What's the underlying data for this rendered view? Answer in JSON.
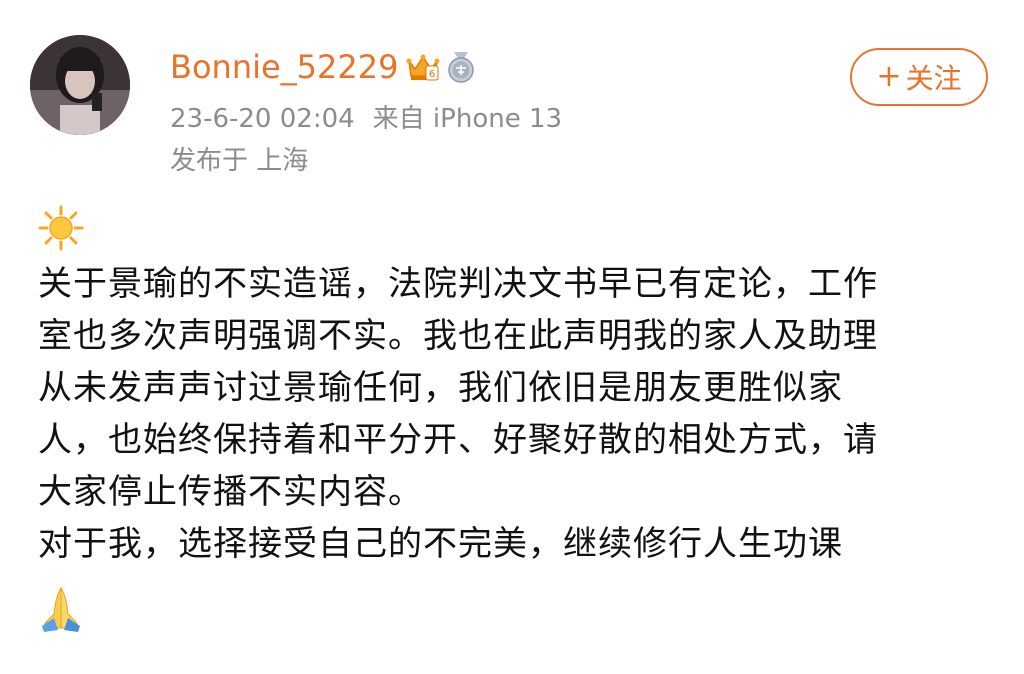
{
  "user": {
    "name": "Bonnie_52229",
    "timestamp": "23-6-20 02:04",
    "source": "来自 iPhone 13",
    "location": "发布于 上海"
  },
  "follow_button": {
    "plus": "+",
    "label": "关注"
  },
  "icons": {
    "avatar": "user-avatar",
    "vip_badge": "crown-badge-icon",
    "medal_badge": "medal-badge-icon",
    "sun": "sun-emoji",
    "pray": "folded-hands-emoji"
  },
  "colors": {
    "username": "#e8732b",
    "meta": "#8c8c8c",
    "follow_border": "#e8732b",
    "body_text": "#111111"
  },
  "content": {
    "lines": [
      " 关于景瑜的不实造谣，法院判决文书早已有定论，工作",
      "室也多次声明强调不实。我也在此声明我的家人及助理",
      "从未发声声讨过景瑜任何，我们依旧是朋友更胜似家",
      "人，也始终保持着和平分开、好聚好散的相处方式，请",
      "大家停止传播不实内容。",
      " 对于我，选择接受自己的不完美，继续修行人生功课"
    ]
  }
}
